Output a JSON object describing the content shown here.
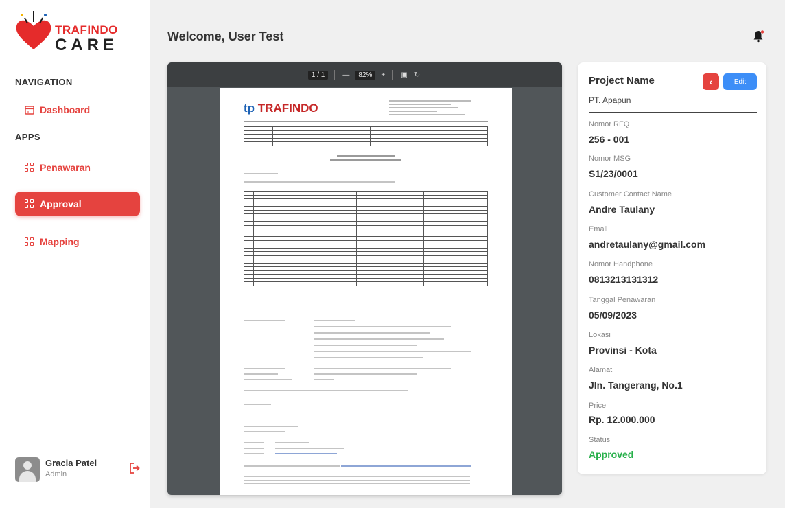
{
  "brand": {
    "line1": "TRAFINDO",
    "line2": "CARE"
  },
  "sidebar": {
    "navigation_label": "NAVIGATION",
    "apps_label": "APPS",
    "items": [
      {
        "label": "Dashboard",
        "icon": "calendar-icon"
      },
      {
        "label": "Penawaran",
        "icon": "grid-icon"
      },
      {
        "label": "Approval",
        "icon": "grid-icon",
        "active": true
      },
      {
        "label": "Mapping",
        "icon": "grid-icon"
      }
    ]
  },
  "user": {
    "name": "Gracia Patel",
    "role": "Admin"
  },
  "header": {
    "title": "Welcome, User Test"
  },
  "viewer": {
    "page_indicator": "1 / 1",
    "zoom": "82%"
  },
  "pdf": {
    "brand": "TRAFINDO"
  },
  "details": {
    "title": "Project Name",
    "project": "PT. Apapun",
    "edit_label": "Edit",
    "fields": [
      {
        "label": "Nomor RFQ",
        "value": "256 - 001"
      },
      {
        "label": "Nomor MSG",
        "value": "S1/23/0001"
      },
      {
        "label": "Customer Contact Name",
        "value": "Andre Taulany"
      },
      {
        "label": "Email",
        "value": "andretaulany@gmail.com"
      },
      {
        "label": "Nomor Handphone",
        "value": "0813213131312"
      },
      {
        "label": "Tanggal Penawaran",
        "value": "05/09/2023"
      },
      {
        "label": "Lokasi",
        "value": "Provinsi - Kota"
      },
      {
        "label": "Alamat",
        "value": "Jln. Tangerang, No.1"
      },
      {
        "label": "Price",
        "value": "Rp. 12.000.000"
      },
      {
        "label": "Status",
        "value": "Approved"
      }
    ]
  },
  "colors": {
    "accent": "#e5433f",
    "edit": "#3d8ef7",
    "approved": "#27b04a"
  }
}
